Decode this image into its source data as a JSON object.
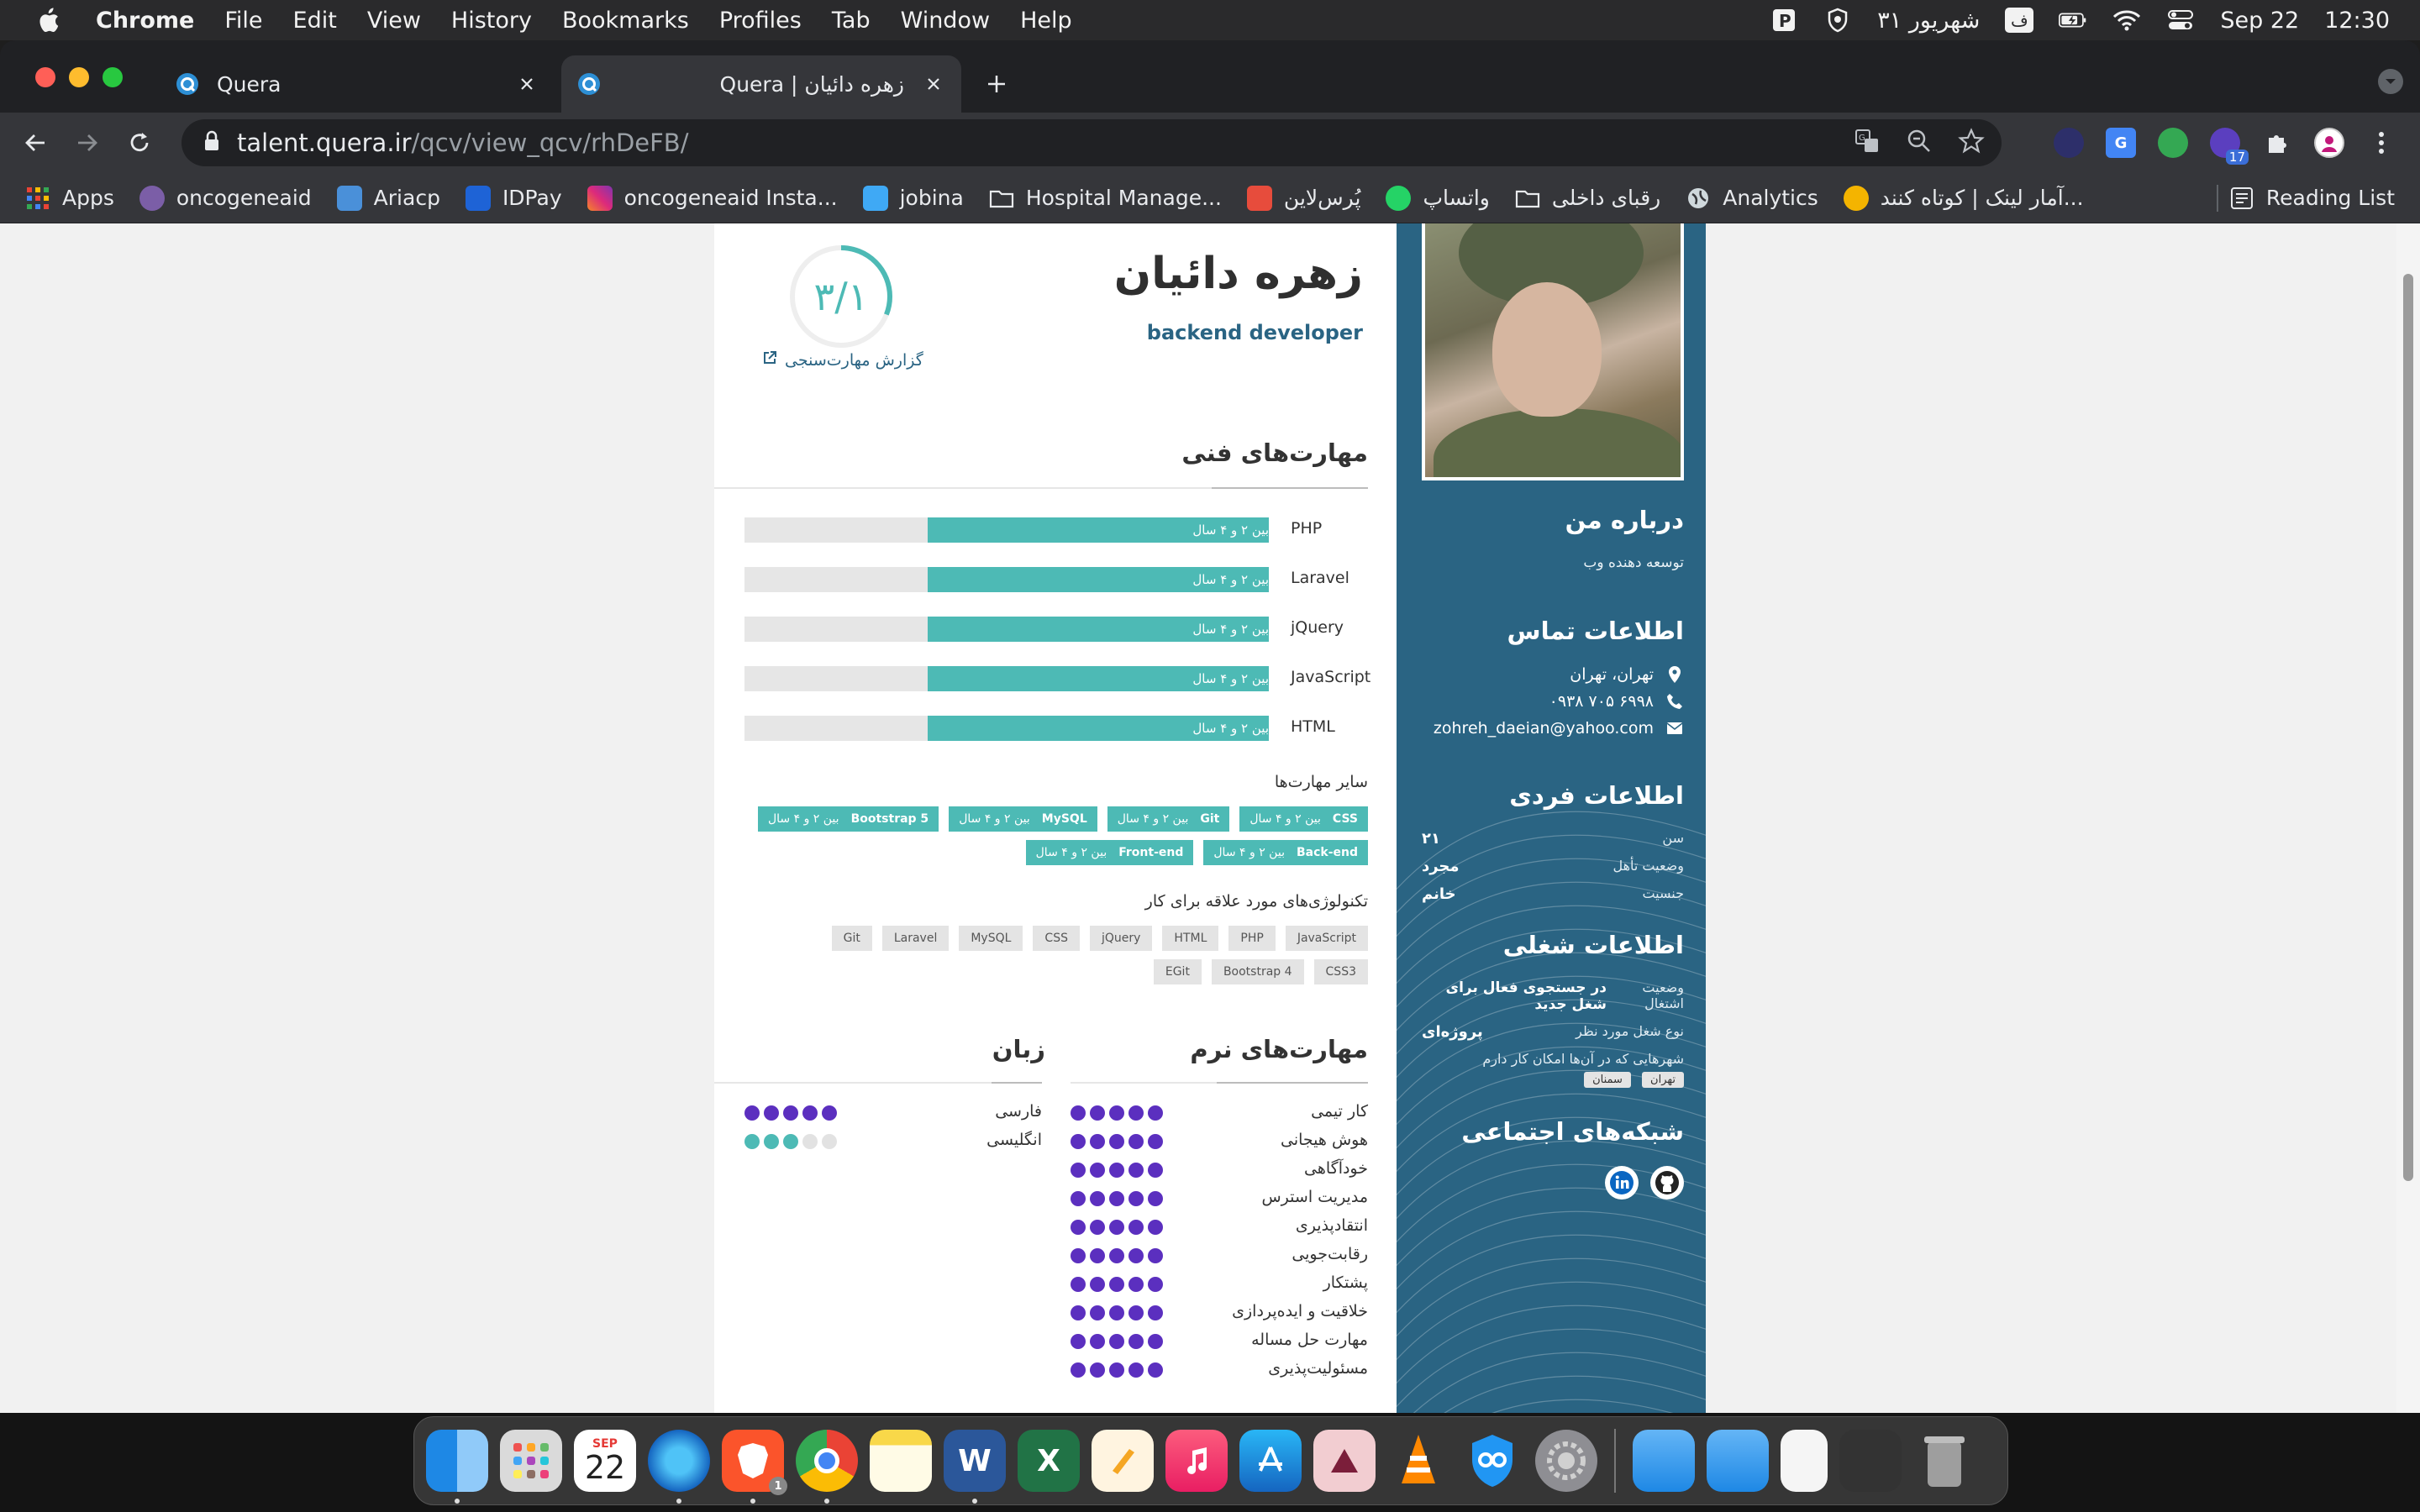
{
  "menubar": {
    "app": "Chrome",
    "items": [
      "File",
      "Edit",
      "View",
      "History",
      "Bookmarks",
      "Profiles",
      "Tab",
      "Window",
      "Help"
    ],
    "persian_date": "۳۱ شهریور",
    "date": "Sep 22",
    "time": "12:30",
    "input_lang": "ف"
  },
  "tabs": [
    {
      "title": "Quera"
    },
    {
      "title": "Quera | زهره دائیان"
    }
  ],
  "omnibox": {
    "host": "talent.quera.ir",
    "path": "/qcv/view_qcv/rhDeFB/"
  },
  "extensions": {
    "badge": "17"
  },
  "bookmarks": [
    {
      "label": "Apps",
      "color": "#ea4335"
    },
    {
      "label": "oncogeneaid",
      "color": "#7b5ea7"
    },
    {
      "label": "Ariacp",
      "color": "#4a90d9"
    },
    {
      "label": "IDPay",
      "color": "#1e63d6"
    },
    {
      "label": "oncogeneaid Insta...",
      "color": "#d6249f"
    },
    {
      "label": "jobina",
      "color": "#3fa9f5"
    },
    {
      "label": "Hospital Manage...",
      "color": "#9aa0a6"
    },
    {
      "label": "پُرس‌لاین",
      "color": "#e74c3c"
    },
    {
      "label": "واتساپ",
      "color": "#25d366"
    },
    {
      "label": "رقبای داخلی",
      "color": "#9aa0a6"
    },
    {
      "label": "Analytics",
      "color": "#cfd8dc"
    },
    {
      "label": "آمار لینک | کوتاه کنند...",
      "color": "#f4b400"
    }
  ],
  "reading_list": "Reading List",
  "profile": {
    "name": "زهره دائیان",
    "role": "backend developer",
    "score": "۳/۱",
    "score_fraction": 0.31,
    "report_link": "گزارش مهارت‌سنجی"
  },
  "tech": {
    "title": "مهارت‌های فنی",
    "skills": [
      {
        "name": "PHP",
        "level": "بین ۲ و ۴ سال",
        "fraction": 0.65
      },
      {
        "name": "Laravel",
        "level": "بین ۲ و ۴ سال",
        "fraction": 0.65
      },
      {
        "name": "jQuery",
        "level": "بین ۲ و ۴ سال",
        "fraction": 0.65
      },
      {
        "name": "JavaScript",
        "level": "بین ۲ و ۴ سال",
        "fraction": 0.65
      },
      {
        "name": "HTML",
        "level": "بین ۲ و ۴ سال",
        "fraction": 0.65
      }
    ],
    "other_title": "سایر مهارت‌ها",
    "other": [
      {
        "name": "CSS",
        "level": "بین ۲ و ۴ سال"
      },
      {
        "name": "Git",
        "level": "بین ۲ و ۴ سال"
      },
      {
        "name": "MySQL",
        "level": "بین ۲ و ۴ سال"
      },
      {
        "name": "Bootstrap 5",
        "level": "بین ۲ و ۴ سال"
      },
      {
        "name": "Back-end",
        "level": "بین ۲ و ۴ سال"
      },
      {
        "name": "Front-end",
        "level": "بین ۲ و ۴ سال"
      }
    ],
    "interest_title": "تکنولوژی‌های مورد علاقه برای کار",
    "interests": [
      "JavaScript",
      "PHP",
      "HTML",
      "jQuery",
      "CSS",
      "MySQL",
      "Laravel",
      "Git",
      "CSS3",
      "Bootstrap 4",
      "EGit"
    ]
  },
  "soft": {
    "title": "مهارت‌های نرم",
    "items": [
      {
        "name": "کار تیمی",
        "rating": 5
      },
      {
        "name": "هوش هیجانی",
        "rating": 5
      },
      {
        "name": "خودآگاهی",
        "rating": 5
      },
      {
        "name": "مدیریت استرس",
        "rating": 5
      },
      {
        "name": "انتقادپذیری",
        "rating": 5
      },
      {
        "name": "رقابت‌جویی",
        "rating": 5
      },
      {
        "name": "پشتکار",
        "rating": 5
      },
      {
        "name": "خلاقیت و ایده‌پردازی",
        "rating": 5
      },
      {
        "name": "مهارت حل مساله",
        "rating": 5
      },
      {
        "name": "مسئولیت‌پذیری",
        "rating": 5
      }
    ]
  },
  "languages": {
    "title": "زبان",
    "items": [
      {
        "name": "فارسی",
        "rating": 5,
        "color": "#5b2fbf"
      },
      {
        "name": "انگلیسی",
        "rating": 3,
        "color": "#4dbab5"
      }
    ]
  },
  "sidebar": {
    "about_title": "درباره من",
    "about_text": "توسعه دهنده وب",
    "contact_title": "اطلاعات تماس",
    "location": "تهران، تهران",
    "phone": "۰۹۳۸ ۷۰۵ ۶۹۹۸",
    "email": "zohreh_daeian@yahoo.com",
    "personal_title": "اطلاعات فردی",
    "personal": [
      {
        "k": "سن",
        "v": "۲۱"
      },
      {
        "k": "وضعیت تأهل",
        "v": "مجرد"
      },
      {
        "k": "جنسیت",
        "v": "خانم"
      }
    ],
    "job_title": "اطلاعات شغلی",
    "job_status_k": "وضعیت اشتغال",
    "job_status_v": "در جستجوی فعال برای شغل جدید",
    "job_type_k": "نوع شغل مورد نظر",
    "job_type_v": "پروژه‌ای",
    "cities_k": "شهرهایی که در آن‌ها امکان کار دارم",
    "cities": [
      "تهران",
      "سمنان"
    ],
    "social_title": "شبکه‌های اجتماعی"
  },
  "dock": {
    "calendar_month": "SEP",
    "calendar_day": "22",
    "brave_badge": "1"
  },
  "colors": {
    "teal": "#4dbab5",
    "sidebar": "#2a6483",
    "purple": "#5b2fbf"
  }
}
